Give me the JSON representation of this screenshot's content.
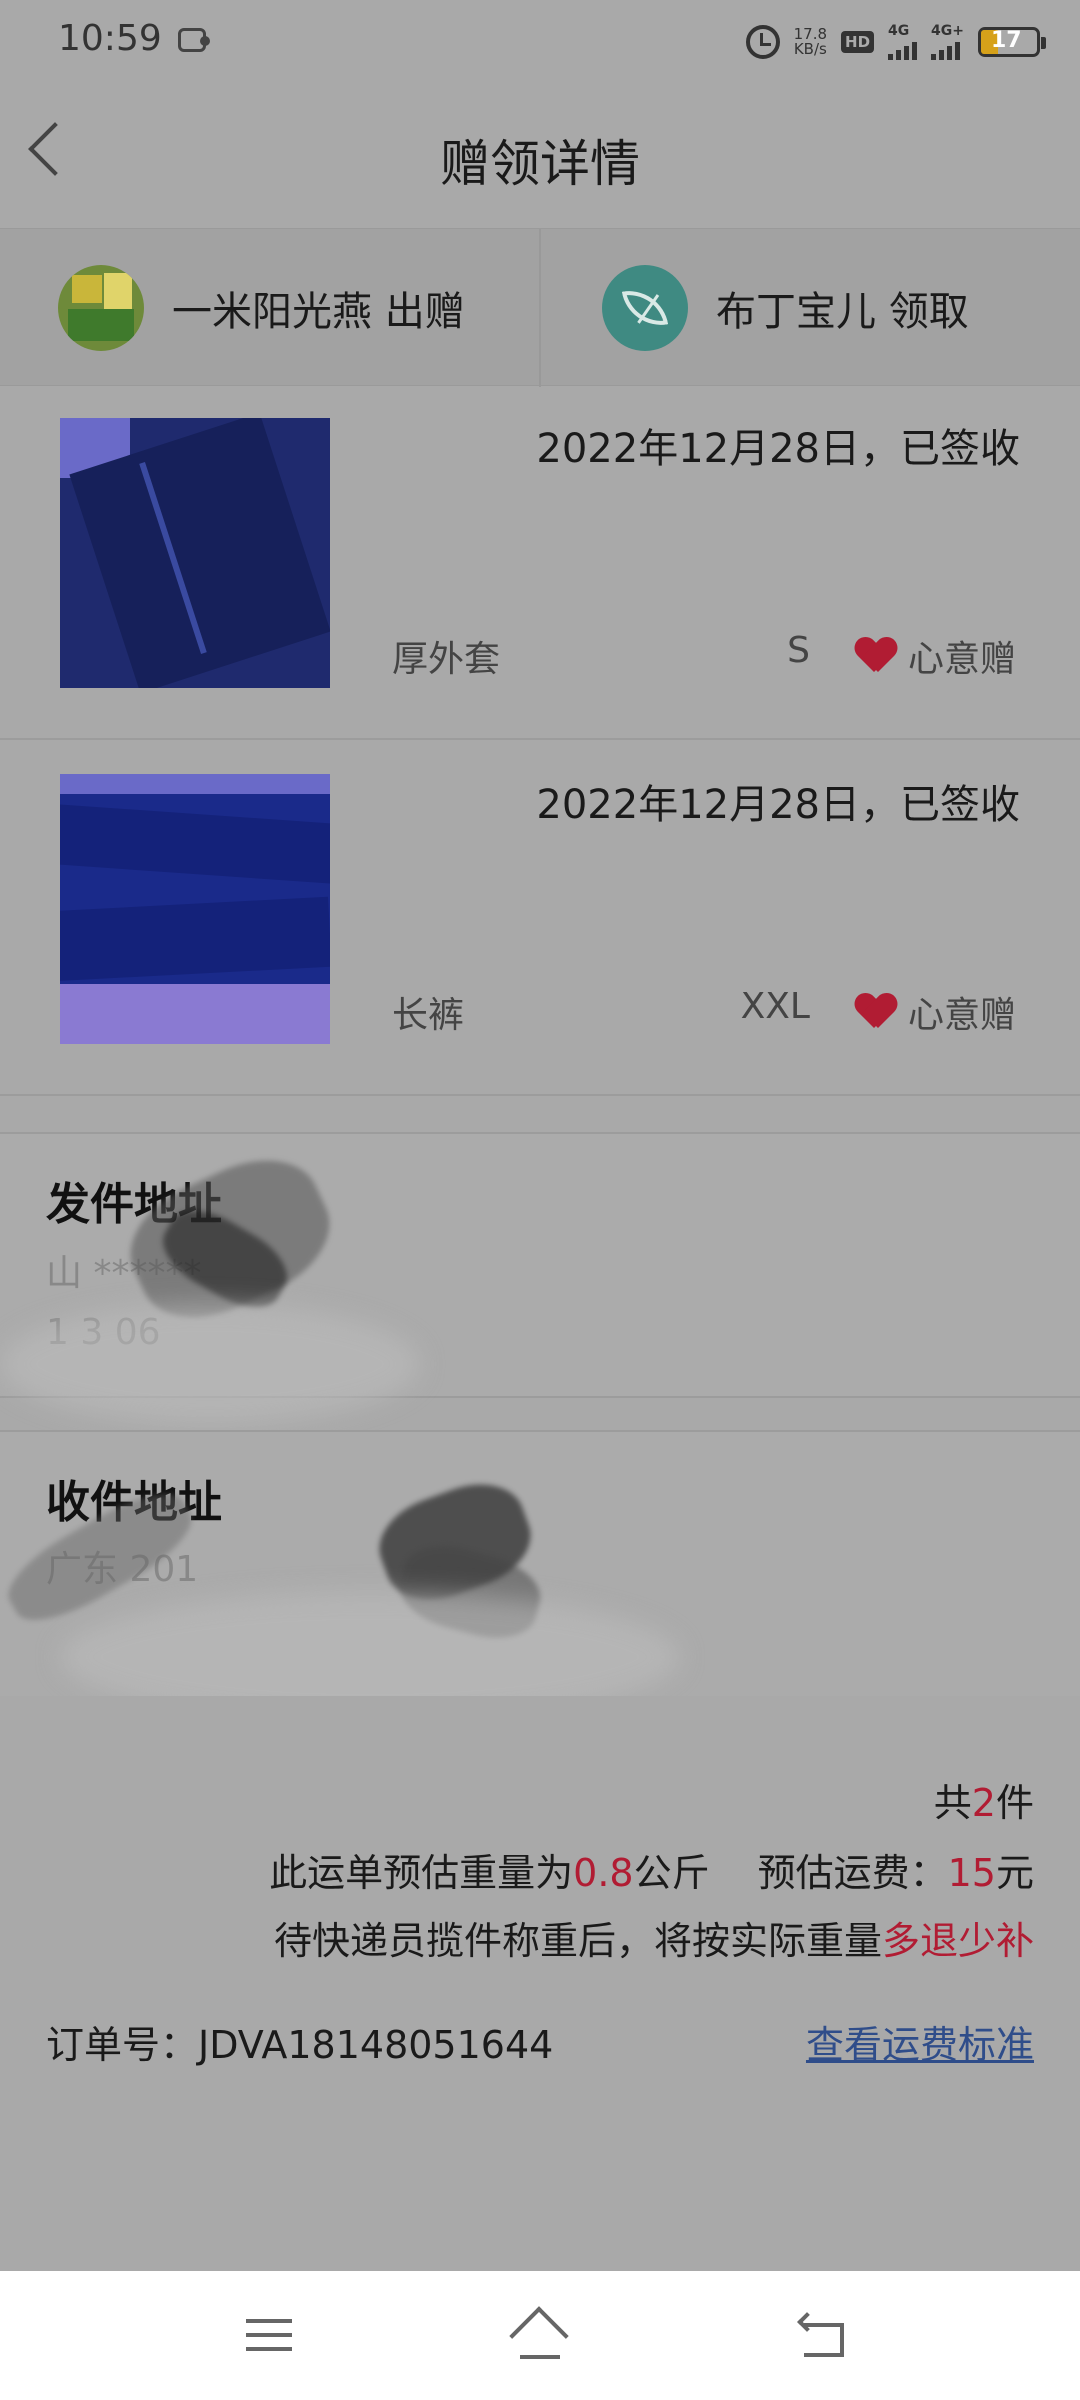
{
  "status_bar": {
    "time": "10:59",
    "net_speed_value": "17.8",
    "net_speed_unit": "KB/s",
    "hd_label": "HD",
    "sim1_label": "4G",
    "sim2_label": "4G+",
    "battery_level": "17",
    "battery_color": "#d6a11a"
  },
  "header": {
    "title": "赠领详情",
    "back_icon": "chevron-left-icon"
  },
  "parties": {
    "donor": {
      "text": "一米阳光燕 出赠",
      "avatar_icon": "donor-avatar"
    },
    "receiver": {
      "text": "布丁宝儿 领取",
      "avatar_icon": "leaf-avatar"
    }
  },
  "items": [
    {
      "status": "2022年12月28日，已签收",
      "name": "厚外套",
      "size": "S",
      "tag": "心意赠",
      "tag_icon": "heart-icon",
      "photo": "coat-photo"
    },
    {
      "status": "2022年12月28日，已签收",
      "name": "长裤",
      "size": "XXL",
      "tag": "心意赠",
      "tag_icon": "heart-icon",
      "photo": "pants-photo"
    }
  ],
  "sender_address": {
    "title": "发件地址",
    "line1": "山 ******",
    "line2": "1 3  06"
  },
  "receiver_address": {
    "title": "收件地址",
    "line1": "广东               201"
  },
  "summary": {
    "count_prefix": "共",
    "count": "2",
    "count_suffix": "件",
    "weight_prefix": "此运单预估重量为",
    "weight": "0.8",
    "weight_unit": "公斤",
    "fee_prefix": "预估运费：",
    "fee": "15",
    "fee_unit": "元",
    "note_prefix": "待快递员揽件称重后，将按实际重量",
    "note_highlight": "多退少补",
    "order_label": "订单号：JDVA18148051644",
    "fee_link": "查看运费标准"
  },
  "colors": {
    "accent_red": "#b11c33",
    "link_blue": "#2f4d8a"
  },
  "navbar": {
    "menu_icon": "menu-icon",
    "home_icon": "home-icon",
    "back_icon": "back-icon"
  }
}
